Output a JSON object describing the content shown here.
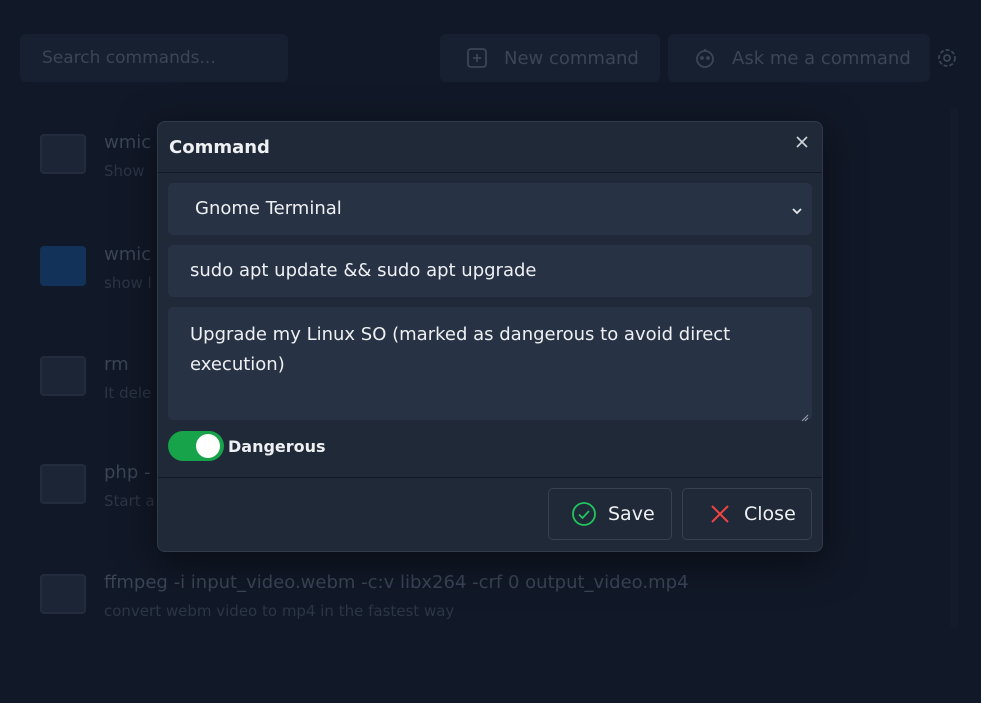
{
  "background": {
    "search_placeholder": "Search commands...",
    "new_command_label": "New command",
    "ask_command_label": "Ask me a command",
    "items": [
      {
        "cmd": "wmic",
        "desc": "Show"
      },
      {
        "cmd": "wmic",
        "desc": "show l"
      },
      {
        "cmd": "rm",
        "desc": "It dele"
      },
      {
        "cmd": "php -",
        "desc": "Start a"
      },
      {
        "cmd": "ffmpeg -i input_video.webm -c:v libx264 -crf 0 output_video.mp4",
        "desc": "convert webm video to mp4 in the fastest way"
      }
    ]
  },
  "modal": {
    "title": "Command",
    "terminal_selected": "Gnome Terminal",
    "command_value": "sudo apt update && sudo apt upgrade",
    "description_value": "Upgrade my Linux SO (marked as dangerous to avoid direct execution)",
    "dangerous_label": "Dangerous",
    "dangerous_on": true,
    "save_label": "Save",
    "close_label": "Close"
  },
  "colors": {
    "accent_green": "#16a34a",
    "danger_red": "#ef4444",
    "modal_bg": "#1f2937",
    "field_bg": "#273244"
  }
}
